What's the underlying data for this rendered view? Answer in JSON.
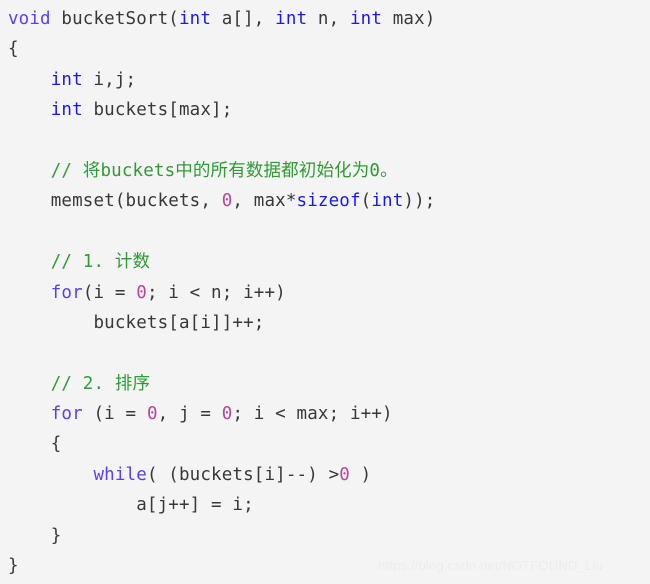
{
  "colors": {
    "background": "#f4f4f4",
    "plain_text": "#37383a",
    "keyword": "#5b3ef0",
    "type": "#1a1ae8",
    "number": "#b5469b",
    "comment": "#2f9b35",
    "watermark": "#ececec"
  },
  "code": {
    "language": "C",
    "function_name": "bucketSort",
    "lines": [
      {
        "indent": 0,
        "tokens": [
          {
            "t": "void",
            "c": "kw"
          },
          {
            "t": " bucketSort(",
            "c": "plain"
          },
          {
            "t": "int",
            "c": "type"
          },
          {
            "t": " a[], ",
            "c": "plain"
          },
          {
            "t": "int",
            "c": "type"
          },
          {
            "t": " n, ",
            "c": "plain"
          },
          {
            "t": "int",
            "c": "type"
          },
          {
            "t": " max)",
            "c": "plain"
          }
        ]
      },
      {
        "indent": 0,
        "tokens": [
          {
            "t": "{",
            "c": "brace"
          }
        ]
      },
      {
        "indent": 1,
        "tokens": [
          {
            "t": "int",
            "c": "type"
          },
          {
            "t": " i,j;",
            "c": "plain"
          }
        ]
      },
      {
        "indent": 1,
        "tokens": [
          {
            "t": "int",
            "c": "type"
          },
          {
            "t": " buckets[max];",
            "c": "plain"
          }
        ]
      },
      {
        "indent": 0,
        "tokens": []
      },
      {
        "indent": 1,
        "tokens": [
          {
            "t": "// 将buckets中的所有数据都初始化为0。",
            "c": "comment"
          }
        ]
      },
      {
        "indent": 1,
        "tokens": [
          {
            "t": "memset(buckets, ",
            "c": "plain"
          },
          {
            "t": "0",
            "c": "num"
          },
          {
            "t": ", max*",
            "c": "plain"
          },
          {
            "t": "sizeof",
            "c": "type"
          },
          {
            "t": "(",
            "c": "plain"
          },
          {
            "t": "int",
            "c": "type"
          },
          {
            "t": "));",
            "c": "plain"
          }
        ]
      },
      {
        "indent": 0,
        "tokens": []
      },
      {
        "indent": 1,
        "tokens": [
          {
            "t": "// 1. 计数",
            "c": "comment"
          }
        ]
      },
      {
        "indent": 1,
        "tokens": [
          {
            "t": "for",
            "c": "kw"
          },
          {
            "t": "(i = ",
            "c": "plain"
          },
          {
            "t": "0",
            "c": "num"
          },
          {
            "t": "; i < n; i++)",
            "c": "plain"
          }
        ]
      },
      {
        "indent": 2,
        "tokens": [
          {
            "t": "buckets[a[i]]++;",
            "c": "plain"
          }
        ]
      },
      {
        "indent": 0,
        "tokens": []
      },
      {
        "indent": 1,
        "tokens": [
          {
            "t": "// 2. 排序",
            "c": "comment"
          }
        ]
      },
      {
        "indent": 1,
        "tokens": [
          {
            "t": "for",
            "c": "kw"
          },
          {
            "t": " (i = ",
            "c": "plain"
          },
          {
            "t": "0",
            "c": "num"
          },
          {
            "t": ", j = ",
            "c": "plain"
          },
          {
            "t": "0",
            "c": "num"
          },
          {
            "t": "; i < max; i++)",
            "c": "plain"
          }
        ]
      },
      {
        "indent": 1,
        "tokens": [
          {
            "t": "{",
            "c": "brace"
          }
        ]
      },
      {
        "indent": 2,
        "tokens": [
          {
            "t": "while",
            "c": "kw"
          },
          {
            "t": "( (buckets[i]--) >",
            "c": "plain"
          },
          {
            "t": "0",
            "c": "num"
          },
          {
            "t": " )",
            "c": "plain"
          }
        ]
      },
      {
        "indent": 3,
        "tokens": [
          {
            "t": "a[j++] = i;",
            "c": "plain"
          }
        ]
      },
      {
        "indent": 1,
        "tokens": [
          {
            "t": "}",
            "c": "brace"
          }
        ]
      },
      {
        "indent": 0,
        "tokens": [
          {
            "t": "}",
            "c": "brace"
          }
        ]
      }
    ]
  },
  "watermark": {
    "text": "https://blog.csdn.net/NOTFOUND_Liu"
  }
}
